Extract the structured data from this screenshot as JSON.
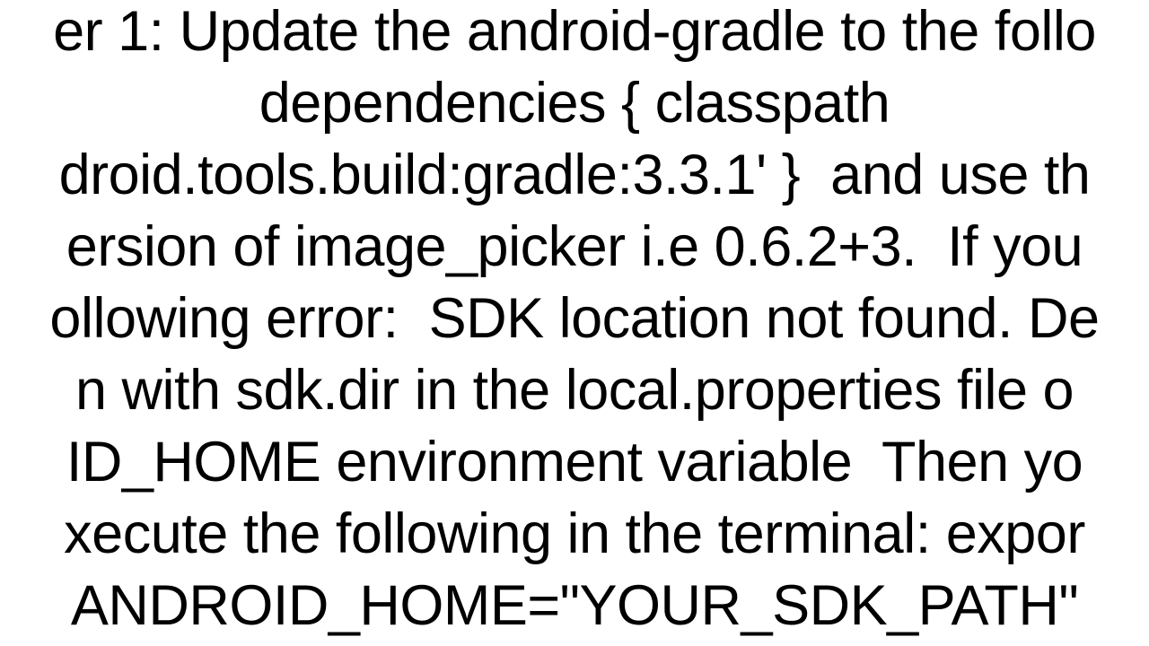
{
  "document": {
    "paragraph": "er 1: Update the android-gradle to the follo\ndependencies { classpath\ndroid.tools.build:gradle:3.3.1' }  and use th\nersion of image_picker i.e 0.6.2+3.  If you\nollowing error:  SDK location not found. De\nn with sdk.dir in the local.properties file o\nID_HOME environment variable  Then yo\nxecute the following in the terminal: expor\nANDROID_HOME=\"YOUR_SDK_PATH\""
  }
}
